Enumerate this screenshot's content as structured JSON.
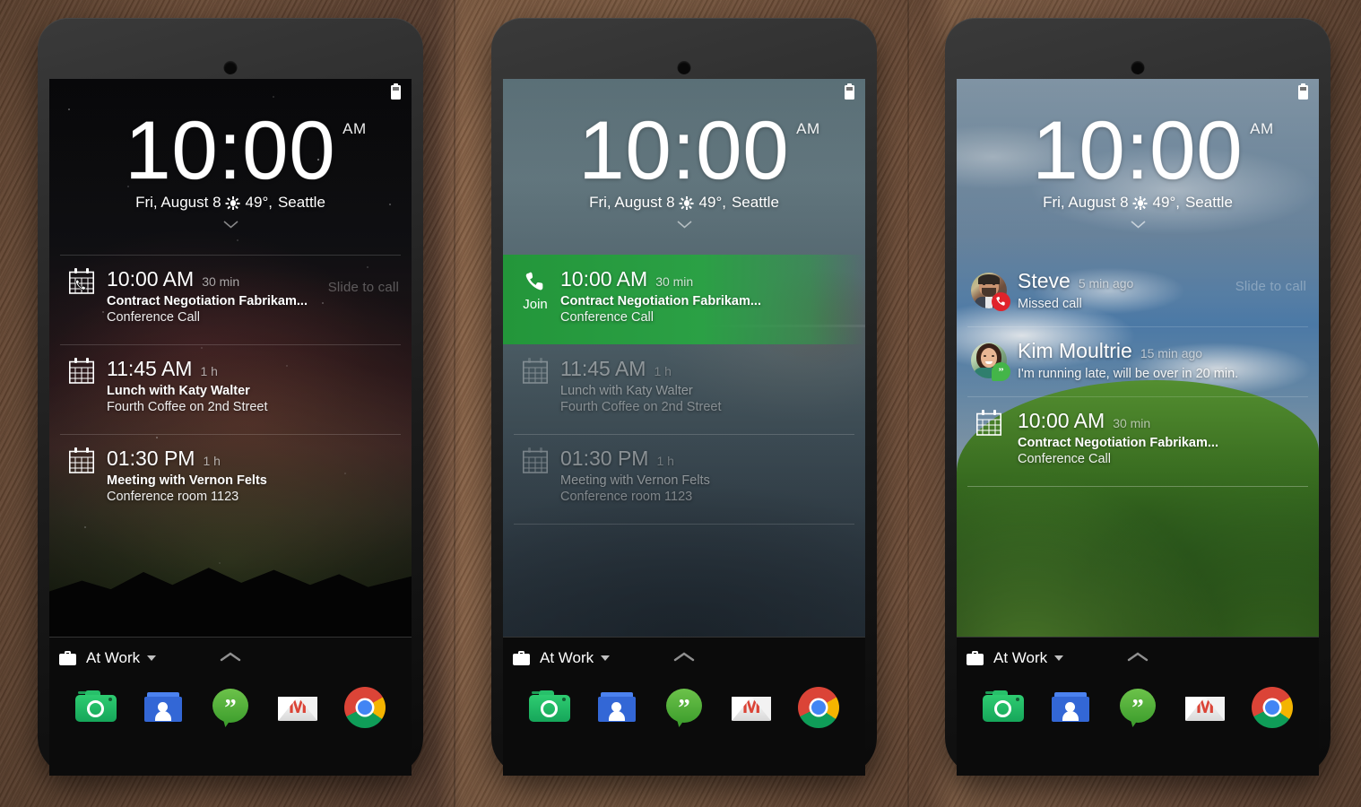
{
  "clock": {
    "time": "10:00",
    "ampm": "AM",
    "date": "Fri, August 8",
    "temperature": "49°,",
    "location": "Seattle",
    "weather_icon": "sun-icon",
    "expand_icon": "chevron-down-icon"
  },
  "status_bar": {
    "battery_icon": "battery-icon"
  },
  "bottom_bar": {
    "profile_icon": "briefcase-icon",
    "profile_label": "At Work",
    "profile_caret_icon": "caret-down-icon",
    "expand_icon": "chevron-up-icon"
  },
  "dock": {
    "items": [
      {
        "name": "camera",
        "icon": "camera-icon"
      },
      {
        "name": "contacts",
        "icon": "contacts-icon"
      },
      {
        "name": "hangouts",
        "icon": "hangouts-icon"
      },
      {
        "name": "gmail",
        "icon": "gmail-icon"
      },
      {
        "name": "chrome",
        "icon": "chrome-icon"
      }
    ]
  },
  "colors": {
    "join_green": "#2ba045",
    "missed_call_red": "#e0232b",
    "hangouts_green": "#44b549"
  },
  "phones": [
    {
      "id": "phone-1",
      "wallpaper": "starfield-aurora",
      "slide_hint": "Slide to call",
      "notifications": [
        {
          "icon": "calendar-call-icon",
          "title": "10:00 AM",
          "duration": "30 min",
          "sub1": "Contract Negotiation Fabrikam...",
          "sub2": "Conference Call",
          "dimmed": false
        },
        {
          "icon": "calendar-icon",
          "title": "11:45 AM",
          "duration": "1 h",
          "sub1": "Lunch with Katy Walter",
          "sub2": "Fourth Coffee on 2nd Street",
          "dimmed": false
        },
        {
          "icon": "calendar-icon",
          "title": "01:30 PM",
          "duration": "1 h",
          "sub1": "Meeting with Vernon Felts",
          "sub2": "Conference room 1123",
          "dimmed": false
        }
      ]
    },
    {
      "id": "phone-2",
      "wallpaper": "misty-sea",
      "slide_hint": "",
      "notifications": [
        {
          "icon": "phone-handset-icon",
          "action_label": "Join",
          "title": "10:00 AM",
          "duration": "30 min",
          "sub1": "Contract Negotiation Fabrikam...",
          "sub2": "Conference Call",
          "highlighted": true,
          "dimmed": false
        },
        {
          "icon": "calendar-icon",
          "title": "11:45 AM",
          "duration": "1 h",
          "sub1": "Lunch with Katy Walter",
          "sub2": "Fourth Coffee on 2nd Street",
          "dimmed": true
        },
        {
          "icon": "calendar-icon",
          "title": "01:30 PM",
          "duration": "1 h",
          "sub1": "Meeting with Vernon Felts",
          "sub2": "Conference room 1123",
          "dimmed": true
        }
      ]
    },
    {
      "id": "phone-3",
      "wallpaper": "blue-sky-green-hills",
      "slide_hint": "Slide to call",
      "notifications": [
        {
          "icon": "avatar-steve",
          "badge": "missed-call-badge",
          "title": "Steve",
          "duration": "5 min ago",
          "sub1": "Missed call",
          "sub2": "",
          "dimmed": false
        },
        {
          "icon": "avatar-kim",
          "badge": "hangouts-badge",
          "title": "Kim Moultrie",
          "duration": "15 min ago",
          "sub1": "I'm running late, will be over in 20 min.",
          "sub2": "",
          "dimmed": false
        },
        {
          "icon": "calendar-icon",
          "title": "10:00 AM",
          "duration": "30 min",
          "sub1": "Contract Negotiation Fabrikam...",
          "sub2": "Conference Call",
          "dimmed": false
        }
      ]
    }
  ]
}
